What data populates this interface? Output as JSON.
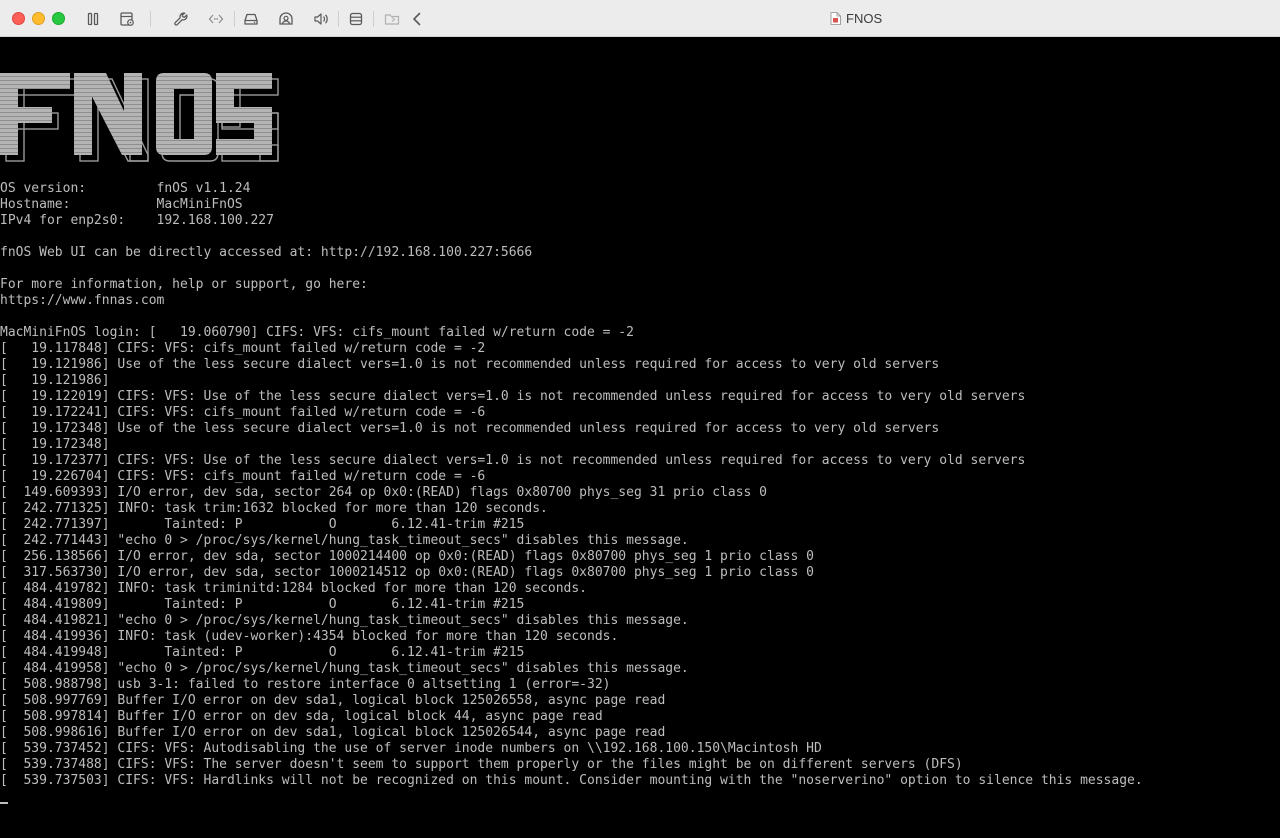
{
  "window": {
    "title": "FNOS"
  },
  "toolbar": {
    "icons": [
      "pause-icon",
      "settings-doc-icon",
      "wrench-icon",
      "code-icon",
      "drive-icon",
      "user-circle-icon",
      "speaker-icon",
      "stack-icon",
      "folder-share-icon",
      "chevron-left-icon"
    ]
  },
  "terminal": {
    "logo": "FNOS",
    "lines": [
      "OS version:         fnOS v1.1.24",
      "Hostname:           MacMiniFnOS",
      "IPv4 for enp2s0:    192.168.100.227",
      "",
      "fnOS Web UI can be directly accessed at: http://192.168.100.227:5666",
      "",
      "For more information, help or support, go here:",
      "https://www.fnnas.com",
      "",
      "MacMiniFnOS login: [   19.060790] CIFS: VFS: cifs_mount failed w/return code = -2",
      "[   19.117848] CIFS: VFS: cifs_mount failed w/return code = -2",
      "[   19.121986] Use of the less secure dialect vers=1.0 is not recommended unless required for access to very old servers",
      "[   19.121986]",
      "[   19.122019] CIFS: VFS: Use of the less secure dialect vers=1.0 is not recommended unless required for access to very old servers",
      "[   19.172241] CIFS: VFS: cifs_mount failed w/return code = -6",
      "[   19.172348] Use of the less secure dialect vers=1.0 is not recommended unless required for access to very old servers",
      "[   19.172348]",
      "[   19.172377] CIFS: VFS: Use of the less secure dialect vers=1.0 is not recommended unless required for access to very old servers",
      "[   19.226704] CIFS: VFS: cifs_mount failed w/return code = -6",
      "[  149.609393] I/O error, dev sda, sector 264 op 0x0:(READ) flags 0x80700 phys_seg 31 prio class 0",
      "[  242.771325] INFO: task trim:1632 blocked for more than 120 seconds.",
      "[  242.771397]       Tainted: P           O       6.12.41-trim #215",
      "[  242.771443] \"echo 0 > /proc/sys/kernel/hung_task_timeout_secs\" disables this message.",
      "[  256.138566] I/O error, dev sda, sector 1000214400 op 0x0:(READ) flags 0x80700 phys_seg 1 prio class 0",
      "[  317.563730] I/O error, dev sda, sector 1000214512 op 0x0:(READ) flags 0x80700 phys_seg 1 prio class 0",
      "[  484.419782] INFO: task triminitd:1284 blocked for more than 120 seconds.",
      "[  484.419809]       Tainted: P           O       6.12.41-trim #215",
      "[  484.419821] \"echo 0 > /proc/sys/kernel/hung_task_timeout_secs\" disables this message.",
      "[  484.419936] INFO: task (udev-worker):4354 blocked for more than 120 seconds.",
      "[  484.419948]       Tainted: P           O       6.12.41-trim #215",
      "[  484.419958] \"echo 0 > /proc/sys/kernel/hung_task_timeout_secs\" disables this message.",
      "[  508.988798] usb 3-1: failed to restore interface 0 altsetting 1 (error=-32)",
      "[  508.997769] Buffer I/O error on dev sda1, logical block 125026558, async page read",
      "[  508.997814] Buffer I/O error on dev sda, logical block 44, async page read",
      "[  508.998616] Buffer I/O error on dev sda1, logical block 125026544, async page read",
      "[  539.737452] CIFS: VFS: Autodisabling the use of server inode numbers on \\\\192.168.100.150\\Macintosh HD",
      "[  539.737488] CIFS: VFS: The server doesn't seem to support them properly or the files might be on different servers (DFS)",
      "[  539.737503] CIFS: VFS: Hardlinks will not be recognized on this mount. Consider mounting with the \"noserverino\" option to silence this message."
    ]
  },
  "colors": {
    "terminal_bg": "#000000",
    "terminal_fg": "#bdbdbd",
    "logo_fill": "#b4b4b4",
    "titlebar_bg": "#ececec"
  }
}
